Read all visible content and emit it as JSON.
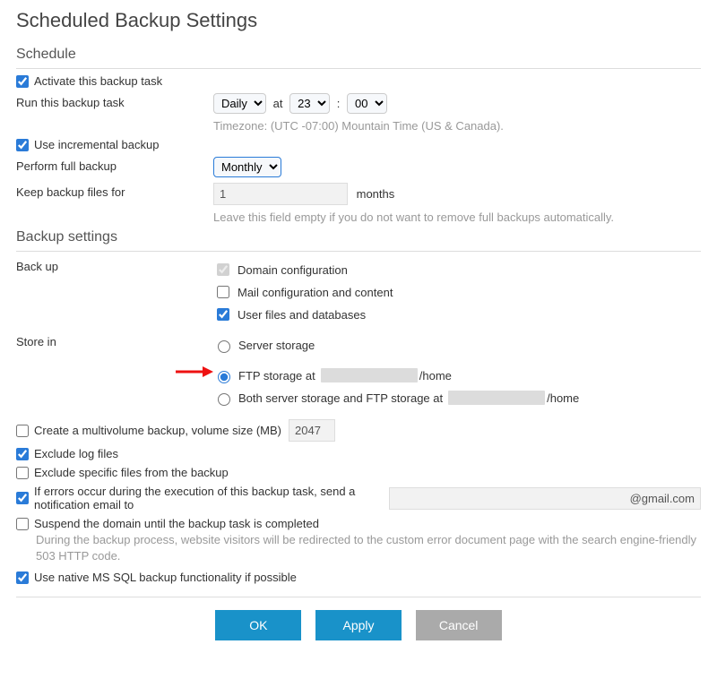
{
  "title": "Scheduled Backup Settings",
  "sections": {
    "schedule": "Schedule",
    "backup": "Backup settings"
  },
  "schedule": {
    "activate_label": "Activate this backup task",
    "run_label": "Run this backup task",
    "frequency": "Daily",
    "at": "at",
    "hour": "23",
    "colon": ":",
    "minute": "00",
    "timezone_note": "Timezone: (UTC -07:00) Mountain Time (US & Canada).",
    "incremental_label": "Use incremental backup",
    "full_label": "Perform full backup",
    "full_freq": "Monthly",
    "keep_label": "Keep backup files for",
    "keep_value": "1",
    "keep_unit": "months",
    "keep_note": "Leave this field empty if you do not want to remove full backups automatically."
  },
  "backup": {
    "backup_label": "Back up",
    "opt_domain": "Domain configuration",
    "opt_mail": "Mail configuration and content",
    "opt_userfiles": "User files and databases",
    "store_label": "Store in",
    "store_server": "Server storage",
    "store_ftp_prefix": "FTP storage at",
    "store_ftp_suffix": "/home",
    "store_both_prefix": "Both server storage and FTP storage at",
    "store_both_suffix": "/home",
    "multivolume_label": "Create a multivolume backup, volume size (MB)",
    "multivolume_value": "2047",
    "exclude_logs": "Exclude log files",
    "exclude_specific": "Exclude specific files from the backup",
    "notify_label": "If errors occur during the execution of this backup task, send a notification email to",
    "notify_value": "@gmail.com",
    "suspend_label": "Suspend the domain until the backup task is completed",
    "suspend_desc": "During the backup process, website visitors will be redirected to the custom error document page with the search engine-friendly 503 HTTP code.",
    "mssql_label": "Use native MS SQL backup functionality if possible"
  },
  "buttons": {
    "ok": "OK",
    "apply": "Apply",
    "cancel": "Cancel"
  }
}
